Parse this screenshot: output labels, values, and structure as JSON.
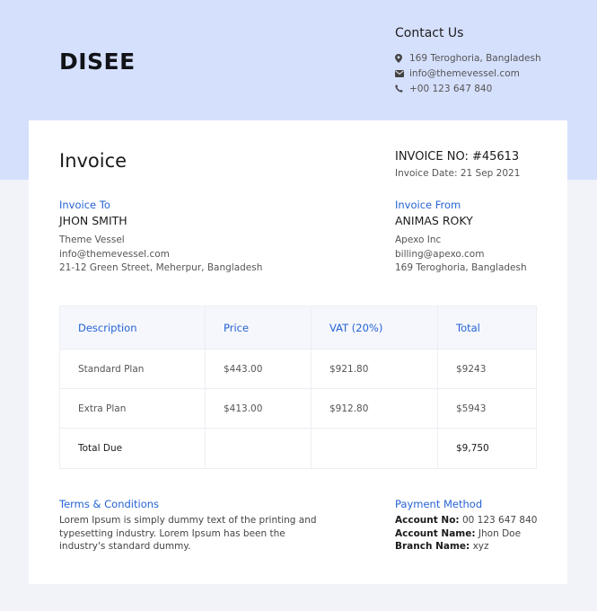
{
  "brand": {
    "logo_text": "DISEE"
  },
  "contact": {
    "title": "Contact Us",
    "address": "169 Teroghoria, Bangladesh",
    "email": "info@themevessel.com",
    "phone": "+00 123 647 840"
  },
  "invoice": {
    "title": "Invoice",
    "number_label": "INVOICE NO: #45613",
    "date_label": "Invoice Date: 21 Sep 2021"
  },
  "invoice_to": {
    "label": "Invoice To",
    "name": "JHON SMITH",
    "lines": [
      "Theme Vessel",
      "info@themevessel.com",
      "21-12 Green Street, Meherpur, Bangladesh"
    ]
  },
  "invoice_from": {
    "label": "Invoice From",
    "name": "ANIMAS ROKY",
    "lines": [
      "Apexo Inc",
      "billing@apexo.com",
      "169 Teroghoria, Bangladesh"
    ]
  },
  "table": {
    "headers": [
      "Description",
      "Price",
      "VAT (20%)",
      "Total"
    ],
    "rows": [
      [
        "Standard Plan",
        "$443.00",
        "$921.80",
        "$9243"
      ],
      [
        "Extra Plan",
        "$413.00",
        "$912.80",
        "$5943"
      ]
    ],
    "total_row": [
      "Total Due",
      "",
      "",
      "$9,750"
    ]
  },
  "terms": {
    "label": "Terms & Conditions",
    "text": "Lorem Ipsum is simply dummy text of the printing and typesetting industry. Lorem Ipsum has been the industry's standard dummy."
  },
  "payment": {
    "label": "Payment Method",
    "account_no_key": "Account No:",
    "account_no_val": "00 123 647 840",
    "account_name_key": "Account Name:",
    "account_name_val": "Jhon Doe",
    "branch_key": "Branch Name:",
    "branch_val": "xyz"
  },
  "colors": {
    "header_band": "#d5e0fd",
    "accent": "#2563d3",
    "page_bg": "#f2f3f8"
  },
  "icons": [
    "map-pin-icon",
    "envelope-icon",
    "phone-icon"
  ]
}
